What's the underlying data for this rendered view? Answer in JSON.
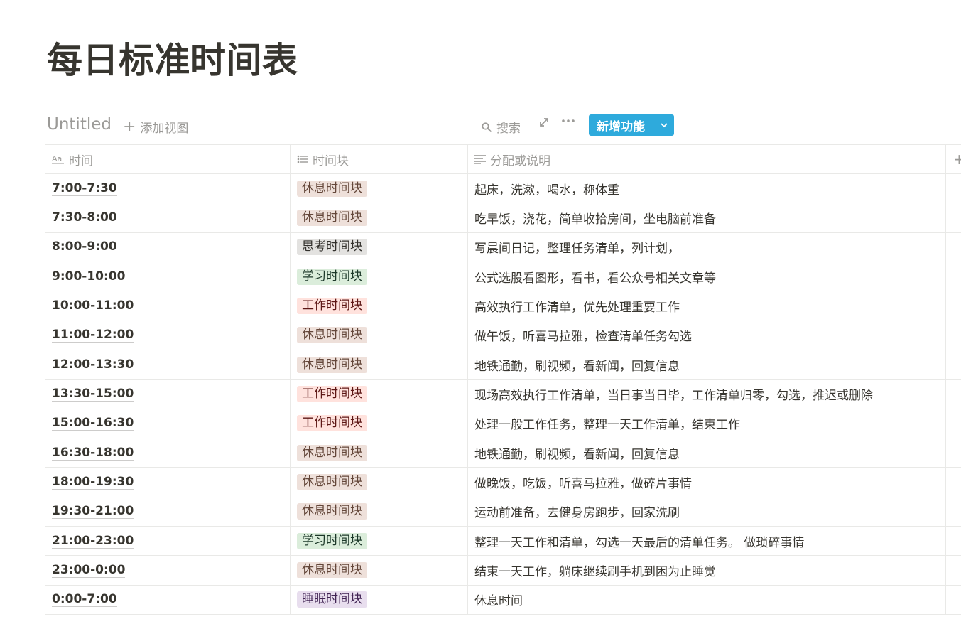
{
  "page": {
    "title": "每日标准时间表"
  },
  "toolbar": {
    "view_name": "Untitled",
    "add_view_label": "添加视图",
    "search_label": "搜索",
    "new_button_label": "新增功能",
    "icons": [
      "search-icon",
      "expand-icon",
      "more-icon",
      "chevron-down-icon"
    ]
  },
  "table": {
    "headers": {
      "time": "时间",
      "block": "时间块",
      "desc": "分配或说明",
      "add": "+"
    },
    "tag_colors": {
      "休息时间块": {
        "bg": "#eee0da",
        "fg": "#64473a"
      },
      "思考时间块": {
        "bg": "#e3e2e0",
        "fg": "#32302c"
      },
      "学习时间块": {
        "bg": "#dbeddb",
        "fg": "#1c3829"
      },
      "工作时间块": {
        "bg": "#ffe2dd",
        "fg": "#5d1715"
      },
      "睡眠时间块": {
        "bg": "#e8deee",
        "fg": "#412454"
      }
    },
    "rows": [
      {
        "time": "7:00-7:30",
        "block": "休息时间块",
        "desc": "起床，洗漱，喝水，称体重"
      },
      {
        "time": "7:30-8:00",
        "block": "休息时间块",
        "desc": "吃早饭，浇花，简单收拾房间，坐电脑前准备"
      },
      {
        "time": "8:00-9:00",
        "block": "思考时间块",
        "desc": "写晨间日记，整理任务清单，列计划，"
      },
      {
        "time": "9:00-10:00",
        "block": "学习时间块",
        "desc": "公式选股看图形，看书，看公众号相关文章等"
      },
      {
        "time": "10:00-11:00",
        "block": "工作时间块",
        "desc": "高效执行工作清单，优先处理重要工作"
      },
      {
        "time": "11:00-12:00",
        "block": "休息时间块",
        "desc": "做午饭，听喜马拉雅，检查清单任务勾选"
      },
      {
        "time": "12:00-13:30",
        "block": "休息时间块",
        "desc": "地铁通勤，刷视频，看新闻，回复信息"
      },
      {
        "time": "13:30-15:00",
        "block": "工作时间块",
        "desc": "现场高效执行工作清单，当日事当日毕，工作清单归零，勾选，推迟或删除"
      },
      {
        "time": "15:00-16:30",
        "block": "工作时间块",
        "desc": "处理一般工作任务，整理一天工作清单，结束工作"
      },
      {
        "time": "16:30-18:00",
        "block": "休息时间块",
        "desc": "地铁通勤，刷视频，看新闻，回复信息"
      },
      {
        "time": "18:00-19:30",
        "block": "休息时间块",
        "desc": "做晚饭，吃饭，听喜马拉雅，做碎片事情"
      },
      {
        "time": "19:30-21:00",
        "block": "休息时间块",
        "desc": "运动前准备，去健身房跑步，回家洗刷"
      },
      {
        "time": "21:00-23:00",
        "block": "学习时间块",
        "desc": "整理一天工作和清单，勾选一天最后的清单任务。 做琐碎事情"
      },
      {
        "time": "23:00-0:00",
        "block": "休息时间块",
        "desc": "结束一天工作，躺床继续刷手机到困为止睡觉"
      },
      {
        "time": "0:00-7:00",
        "block": "睡眠时间块",
        "desc": "休息时间"
      }
    ]
  }
}
